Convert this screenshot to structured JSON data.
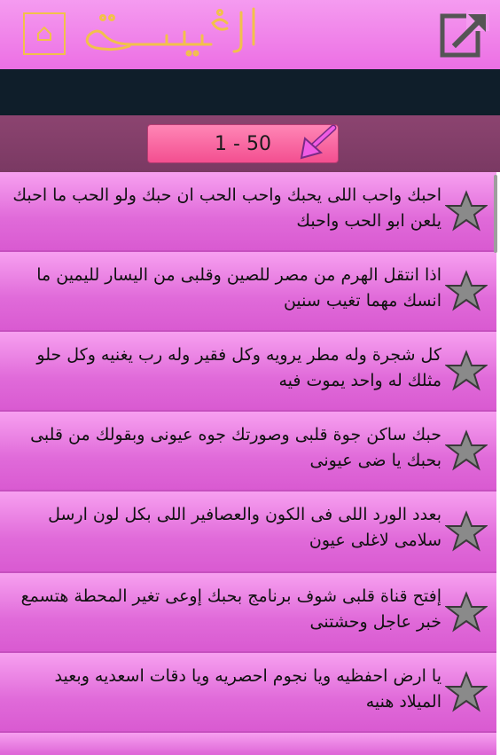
{
  "header": {
    "title": "الرؤية",
    "title_color": "#f2c14a",
    "home_icon": "home-outline-icon",
    "share_icon": "external-link-icon"
  },
  "pager": {
    "range_label": "1 - 50",
    "arrow_icon": "pink-arrow-icon"
  },
  "items": [
    {
      "text": "احبك واحب اللى يحبك واحب الحب ان حبك ولو الحب ما احبك يلعن ابو الحب واحبك",
      "icon": "star-icon"
    },
    {
      "text": "اذا انتقل الهرم من مصر للصين وقلبى من اليسار لليمين ما انسك مهما تغيب سنين",
      "icon": "star-icon"
    },
    {
      "text": "كل شجرة وله مطر يرويه وكل فقير وله رب يغنيه وكل حلو مثلك له واحد يموت فيه",
      "icon": "star-icon"
    },
    {
      "text": "حبك ساكن جوة قلبى وصورتك جوه عيونى وبقولك من قلبى بحبك يا ضى عيونى",
      "icon": "star-icon"
    },
    {
      "text": "بعدد الورد اللى فى الكون والعصافير اللى بكل لون ارسل سلامى لاغلى عيون",
      "icon": "star-icon"
    },
    {
      "text": "إفتح قناة قلبى شوف برنامج بحبك إوعى تغير المحطة هتسمع خبر عاجل وحشتنى",
      "icon": "star-icon"
    },
    {
      "text": "يا ارض احفظيه ويا نجوم احصريه ويا دقات اسعديه وبعيد الميلاد هنيه",
      "icon": "star-icon"
    }
  ]
}
